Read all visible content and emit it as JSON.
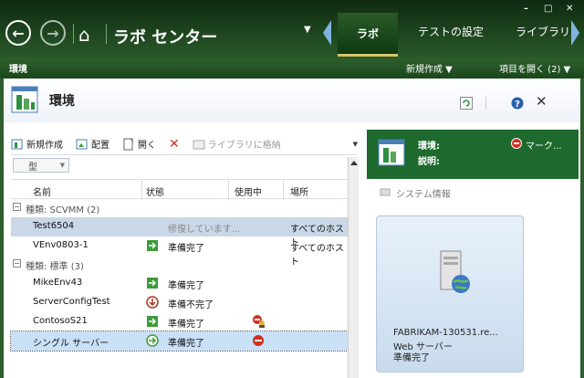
{
  "app": {
    "title": "ラボ センター",
    "tabs": [
      {
        "label": "ラボ",
        "active": true
      },
      {
        "label": "テストの設定"
      },
      {
        "label": "ライブラリ"
      }
    ],
    "window_buttons": [
      "–",
      "□",
      "✕"
    ]
  },
  "subbar": {
    "left_label": "環境",
    "new_label": "新規作成",
    "open_label": "項目を開く (2)"
  },
  "panel": {
    "title": "環境",
    "toolbar": {
      "new": "新規作成",
      "deploy": "配置",
      "open": "開く",
      "store": "ライブラリに格納"
    },
    "filter": "型",
    "columns": [
      "名前",
      "状態",
      "使用中",
      "場所"
    ],
    "groups": [
      {
        "label": "種類: SCVMM (2)",
        "rows": [
          {
            "name": "Test6504",
            "status": "修復しています...",
            "location": "すべてのホスト",
            "state": "busy"
          },
          {
            "name": "VEnv0803-1",
            "status": "準備完了",
            "location": "すべてのホスト",
            "state": "ready"
          }
        ]
      },
      {
        "label": "種類: 標準 (3)",
        "rows": [
          {
            "name": "MikeEnv43",
            "status": "準備完了",
            "location": "",
            "state": "ready"
          },
          {
            "name": "ServerConfigTest",
            "status": "準備不完了",
            "location": "",
            "state": "notready"
          },
          {
            "name": "ContosoS21",
            "status": "準備完了",
            "location": "",
            "state": "ready",
            "inuse": "user"
          },
          {
            "name": "シングル サーバー",
            "status": "準備完了",
            "location": "",
            "state": "ready-circle",
            "inuse": "stop"
          }
        ]
      }
    ]
  },
  "detail": {
    "env_label": "環境:",
    "desc_label": "説明:",
    "mark_label": "マーク...",
    "system_info": "システム情報",
    "card": {
      "name": "FABRIKAM-130531.re...",
      "role": "Web サーバー",
      "status": "準備完了"
    }
  },
  "colors": {
    "accent_green": "#1e6a2e",
    "ready_green": "#3f9a3a",
    "stop_red": "#d03020"
  }
}
